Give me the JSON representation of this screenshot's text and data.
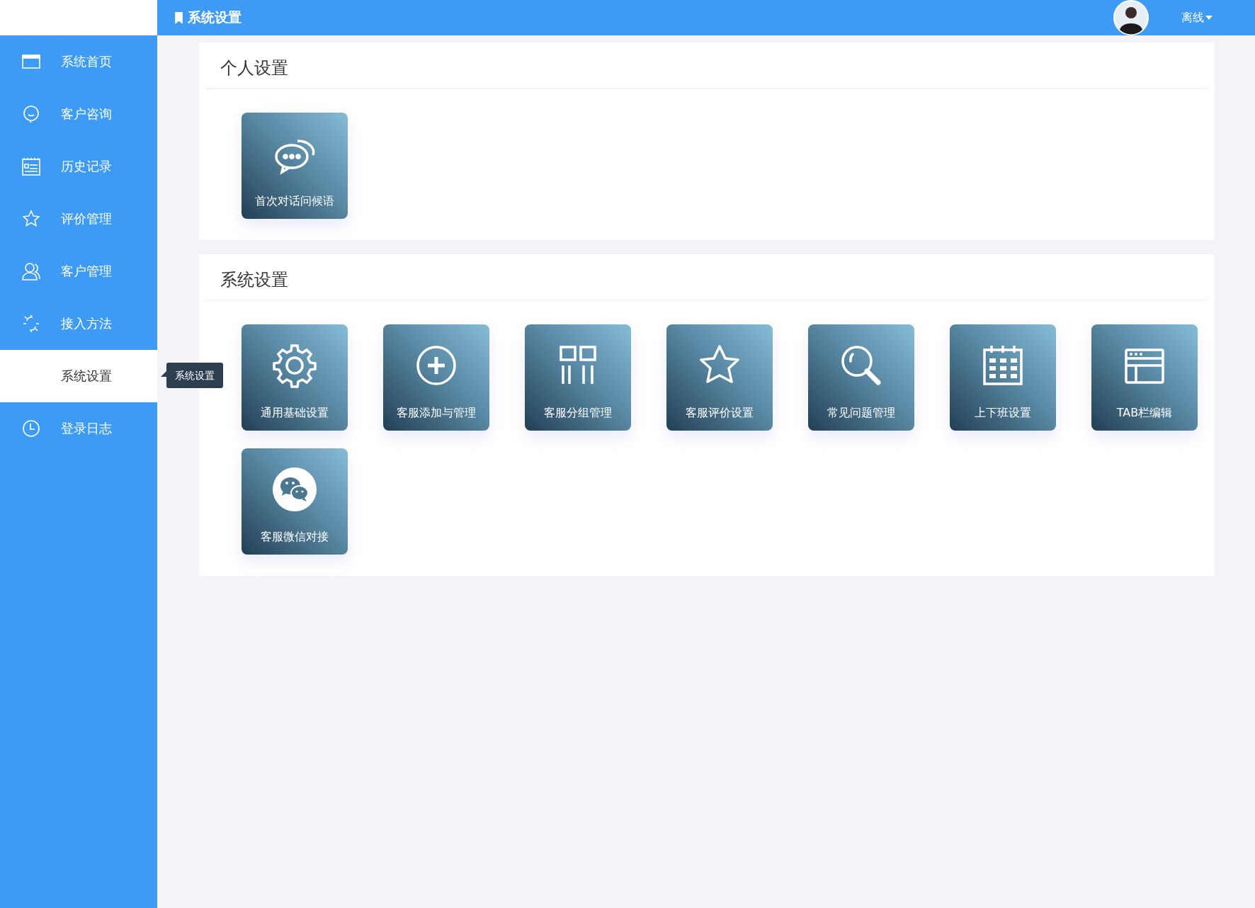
{
  "header": {
    "title": "系统设置",
    "status": "离线"
  },
  "sidebar": {
    "items": [
      {
        "label": "系统首页",
        "selected": false
      },
      {
        "label": "客户咨询",
        "selected": false
      },
      {
        "label": "历史记录",
        "selected": false
      },
      {
        "label": "评价管理",
        "selected": false
      },
      {
        "label": "客户管理",
        "selected": false
      },
      {
        "label": "接入方法",
        "selected": false
      },
      {
        "label": "系统设置",
        "selected": true
      },
      {
        "label": "登录日志",
        "selected": false
      }
    ]
  },
  "tooltip": "系统设置",
  "sections": [
    {
      "title": "个人设置",
      "tiles": [
        {
          "label": "首次对话问候语",
          "kind": "chat"
        }
      ]
    },
    {
      "title": "系统设置",
      "tiles": [
        {
          "label": "通用基础设置",
          "kind": "gear"
        },
        {
          "label": "客服添加与管理",
          "kind": "plus"
        },
        {
          "label": "客服分组管理",
          "kind": "columns"
        },
        {
          "label": "客服评价设置",
          "kind": "star"
        },
        {
          "label": "常见问题管理",
          "kind": "search"
        },
        {
          "label": "上下班设置",
          "kind": "calendar"
        },
        {
          "label": "TAB栏编辑",
          "kind": "window"
        },
        {
          "label": "客服微信对接",
          "kind": "wechat"
        }
      ]
    }
  ]
}
